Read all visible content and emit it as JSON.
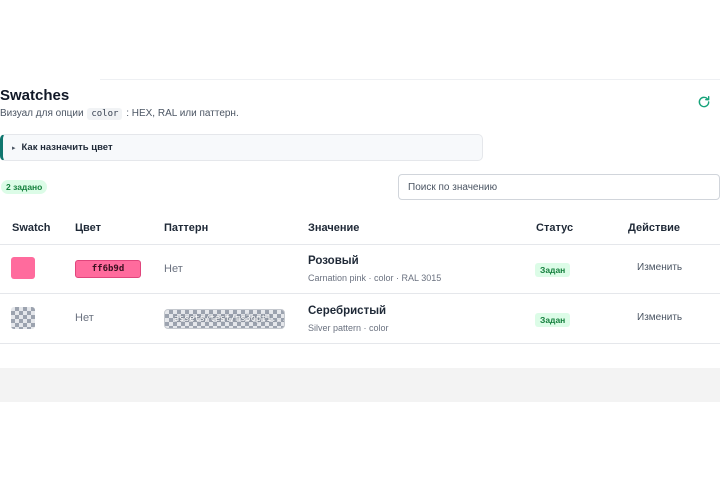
{
  "header": {
    "title": "Swatches",
    "subtitle_prefix": "Визуал для опции",
    "subtitle_code": "color",
    "subtitle_suffix": ": HEX, RAL или паттерн."
  },
  "icons": {
    "refresh": "refresh-icon",
    "caret": "caret-right-icon"
  },
  "details": {
    "caret": "▸",
    "summary": "Как назначить цвет"
  },
  "toolbar": {
    "count_badge": "2 задано",
    "search_placeholder": "Поиск по значению"
  },
  "table": {
    "columns": [
      "Swatch",
      "Цвет",
      "Паттерн",
      "Значение",
      "Статус",
      "Действие"
    ],
    "rows": [
      {
        "swatch_color": "#ff6b9d",
        "color_hex": "ff6b9d",
        "pattern": "Нет",
        "value_name": "Розовый",
        "value_meta": "Carnation pink · color · RAL 3015",
        "status": "Задан",
        "action": "Изменить"
      },
      {
        "swatch": "checker-pattern",
        "color": "Нет",
        "pattern_path": "assets/test/ms3opt1...",
        "value_name": "Серебристый",
        "value_meta": "Silver pattern · color",
        "status": "Задан",
        "action": "Изменить"
      }
    ]
  },
  "colors": {
    "accent": "#0f766e",
    "refresh_icon": "#16a37a",
    "status_bg": "#dcfce7",
    "status_text": "#15803d",
    "pink": "#ff6b9d"
  }
}
